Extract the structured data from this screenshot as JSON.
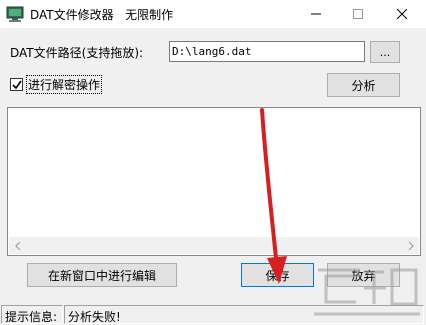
{
  "window": {
    "title": "DAT文件修改器   无限制作",
    "icon": "monitor-app-icon"
  },
  "form": {
    "path_label": "DAT文件路径(支持拖放):",
    "path_value": "D:\\lang6.dat",
    "browse_label": "...",
    "decrypt_checked": true,
    "decrypt_label": "进行解密操作",
    "analyze_label": "分析"
  },
  "content": {
    "text": ""
  },
  "actions": {
    "edit_new_window_label": "在新窗口中进行编辑",
    "save_label": "保存",
    "discard_label": "放弃"
  },
  "status": {
    "label": "提示信息:",
    "message": "分析失败!"
  },
  "colors": {
    "annotation_arrow": "#e02020",
    "window_bg": "#f0f0f0"
  }
}
